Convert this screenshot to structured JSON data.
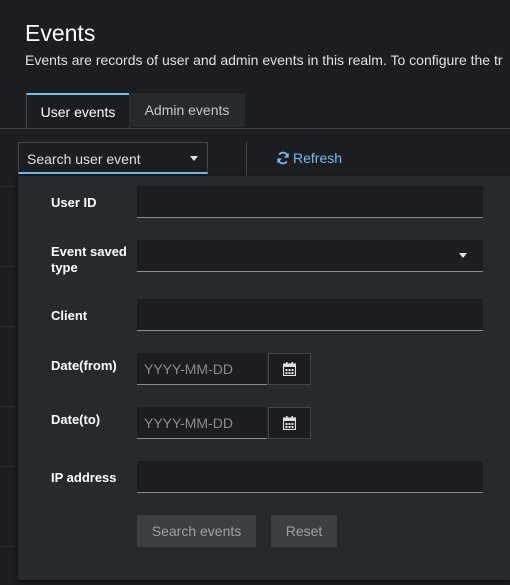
{
  "header": {
    "title": "Events",
    "description": "Events are records of user and admin events in this realm. To configure the tr"
  },
  "tabs": [
    {
      "label": "User events",
      "active": true
    },
    {
      "label": "Admin events",
      "active": false
    }
  ],
  "toolbar": {
    "search_select_label": "Search user event",
    "refresh_label": "Refresh"
  },
  "search_form": {
    "user_id_label": "User ID",
    "user_id_value": "",
    "event_type_label_line1": "Event saved",
    "event_type_label_line2": "type",
    "event_type_value": "",
    "client_label": "Client",
    "client_value": "",
    "date_from_label": "Date(from)",
    "date_from_placeholder": "YYYY-MM-DD",
    "date_to_label": "Date(to)",
    "date_to_placeholder": "YYYY-MM-DD",
    "ip_label": "IP address",
    "ip_value": "",
    "search_button": "Search events",
    "reset_button": "Reset"
  },
  "colors": {
    "accent": "#73bcf7",
    "background": "#1b1d21",
    "panel": "#26292d"
  },
  "icons": [
    "refresh-icon",
    "calendar-icon",
    "caret-down-icon"
  ]
}
